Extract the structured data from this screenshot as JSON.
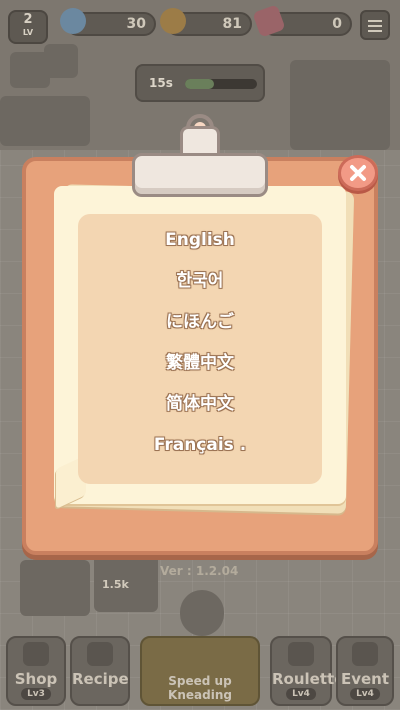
{
  "hud": {
    "level_number": "2",
    "level_label": "LV",
    "gems": "30",
    "coins": "81",
    "tickets": "0"
  },
  "oven": {
    "timer": "15s",
    "progress": 0.4
  },
  "language_menu": {
    "items": [
      {
        "label": "English"
      },
      {
        "label": "한국어"
      },
      {
        "label": "にほんご"
      },
      {
        "label": "繁體中文"
      },
      {
        "label": "简体中文"
      },
      {
        "label": "Français ."
      }
    ]
  },
  "footer": {
    "version": "Ver : 1.2.04",
    "bread_count": "1.5k"
  },
  "bottom_nav": {
    "shop": {
      "label": "Shop",
      "level": "Lv3"
    },
    "recipe": {
      "label": "Recipe"
    },
    "speed_up": {
      "label": "Speed up Kneading"
    },
    "roulette": {
      "label": "Roulette",
      "level": "Lv4"
    },
    "event": {
      "label": "Event",
      "level": "Lv4"
    }
  },
  "colors": {
    "board": "#e7a27b",
    "paper": "#fdf4d8",
    "list_panel": "#f3d6b2",
    "close_button": "#f29a86"
  },
  "icons": {
    "close": "close-icon",
    "menu": "menu-icon",
    "gem": "gem-icon",
    "coin": "coin-icon",
    "ticket": "ticket-icon"
  }
}
